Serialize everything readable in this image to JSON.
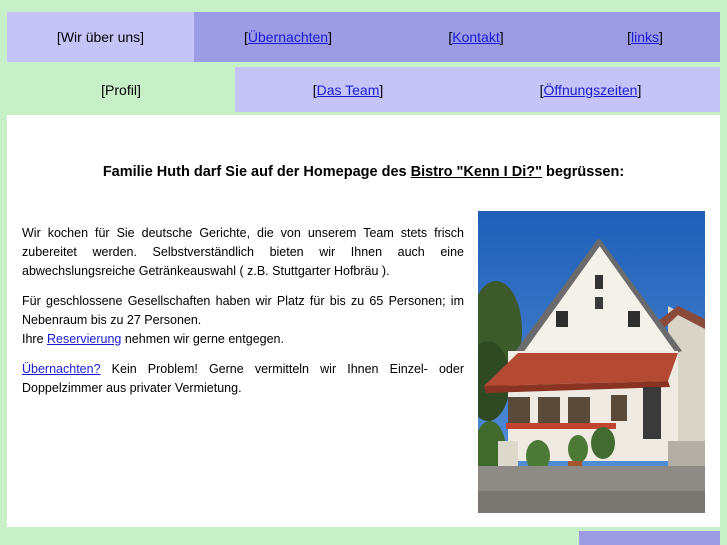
{
  "top_nav": [
    {
      "open": "[",
      "label": "Wir über uns",
      "close": "]",
      "link": false
    },
    {
      "open": "[",
      "label": "Übernachten",
      "close": "]",
      "link": true
    },
    {
      "open": "[",
      "label": "Kontakt",
      "close": "]",
      "link": true
    },
    {
      "open": "[",
      "label": "links",
      "close": "]",
      "link": true
    }
  ],
  "sub_nav": [
    {
      "open": "[",
      "label": "Profil",
      "close": "]",
      "link": false
    },
    {
      "open": "[",
      "label": "Das Team",
      "close": "]",
      "link": true
    },
    {
      "open": "[",
      "label": "Öffnungszeiten",
      "close": "]",
      "link": true
    }
  ],
  "headline": {
    "before": "Familie Huth darf Sie auf der Homepage des ",
    "link": "Bistro \"Kenn I Di?\"",
    "after": " begrüssen:"
  },
  "paragraphs": {
    "p1": "Wir kochen für Sie deutsche Gerichte, die von unserem Team stets frisch zubereitet werden. Selbstverständlich bieten wir Ihnen auch eine abwechslungsreiche Getränkeauswahl ( z.B. Stuttgarter Hofbräu ).",
    "p2_line1": "Für geschlossene Gesellschaften haben wir Platz für bis zu 65 Personen; im Nebenraum bis zu 27 Personen.",
    "p2_pre": "Ihre ",
    "p2_link": "Reservierung",
    "p2_post": " nehmen wir gerne entgegen.",
    "p3_link": "Übernachten?",
    "p3_post": " Kein Problem! Gerne vermitteln wir Ihnen Einzel- oder Doppelzimmer aus privater Vermietung."
  },
  "colors": {
    "green": "#c8f0c8",
    "nav_blue": "#9c9ce4",
    "nav_light": "#c4c4f8",
    "link": "#1a1ad6"
  }
}
